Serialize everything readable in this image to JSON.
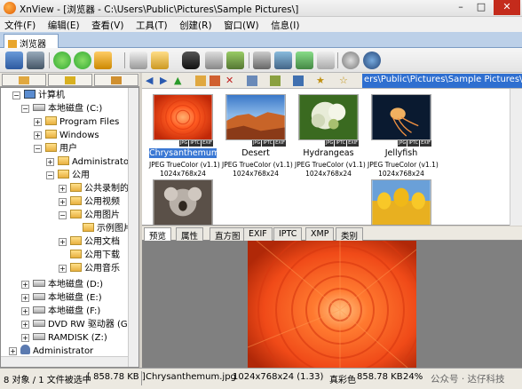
{
  "window": {
    "title": "XnView - [浏览器 - C:\\Users\\Public\\Pictures\\Sample Pictures\\]",
    "buttons": {
      "minimize": "–",
      "maximize": "□",
      "close": "✕"
    }
  },
  "menu": [
    "文件(F)",
    "编辑(E)",
    "查看(V)",
    "工具(T)",
    "创建(R)",
    "窗口(W)",
    "信息(I)"
  ],
  "doc_tab": "浏览器",
  "address": "ers\\Public\\Pictures\\Sample Pictures\\",
  "tree": {
    "items": [
      {
        "label": "计算机",
        "type": "pc",
        "expander": "−"
      },
      {
        "label": "本地磁盘 (C:)",
        "type": "drive",
        "expander": "−"
      },
      {
        "label": "Program Files",
        "type": "folder",
        "expander": "+"
      },
      {
        "label": "Windows",
        "type": "folder",
        "expander": "+"
      },
      {
        "label": "用户",
        "type": "folder",
        "expander": "−"
      },
      {
        "label": "Administrator",
        "type": "folder",
        "expander": "+"
      },
      {
        "label": "公用",
        "type": "folder",
        "expander": "−"
      },
      {
        "label": "公共录制的",
        "type": "folder",
        "expander": "+"
      },
      {
        "label": "公用视频",
        "type": "folder",
        "expander": "+"
      },
      {
        "label": "公用图片",
        "type": "folder",
        "expander": "−"
      },
      {
        "label": "示例图片",
        "type": "folder",
        "expander": ""
      },
      {
        "label": "公用文档",
        "type": "folder",
        "expander": "+"
      },
      {
        "label": "公用下载",
        "type": "folder",
        "expander": ""
      },
      {
        "label": "公用音乐",
        "type": "folder",
        "expander": "+"
      },
      {
        "label": "本地磁盘 (D:)",
        "type": "drive",
        "expander": "+"
      },
      {
        "label": "本地磁盘 (E:)",
        "type": "drive",
        "expander": "+"
      },
      {
        "label": "本地磁盘 (F:)",
        "type": "drive",
        "expander": "+"
      },
      {
        "label": "DVD RW 驱动器 (G:)",
        "type": "drive",
        "expander": "+"
      },
      {
        "label": "RAMDISK (Z:)",
        "type": "drive",
        "expander": "+"
      },
      {
        "label": "Administrator",
        "type": "user",
        "expander": "+"
      }
    ]
  },
  "thumbnails": {
    "badges": [
      "JPG",
      "IPTC",
      "EXIF"
    ],
    "items": [
      {
        "name": "Chrysanthemum",
        "format": "JPEG TrueColor (v1.1)",
        "dims": "1024x768x24",
        "selected": true
      },
      {
        "name": "Desert",
        "format": "JPEG TrueColor (v1.1)",
        "dims": "1024x768x24",
        "selected": false
      },
      {
        "name": "Hydrangeas",
        "format": "JPEG TrueColor (v1.1)",
        "dims": "1024x768x24",
        "selected": false
      },
      {
        "name": "Jellyfish",
        "format": "JPEG TrueColor (v1.1)",
        "dims": "1024x768x24",
        "selected": false
      }
    ]
  },
  "preview_tabs": [
    "预览",
    "属性",
    "直方图",
    "EXIF",
    "IPTC",
    "XMP",
    "类别"
  ],
  "status": {
    "objects": "8 对象 / 1 文件被选中",
    "selected_size": "[ 858.78 KB ]",
    "filename": "Chrysanthemum.jpg",
    "dimensions": "1024x768x24 (1.33)",
    "color": "真彩色",
    "file_size": "858.78 KB",
    "zoom": "24%"
  },
  "watermark": "公众号 · 达仔科技"
}
